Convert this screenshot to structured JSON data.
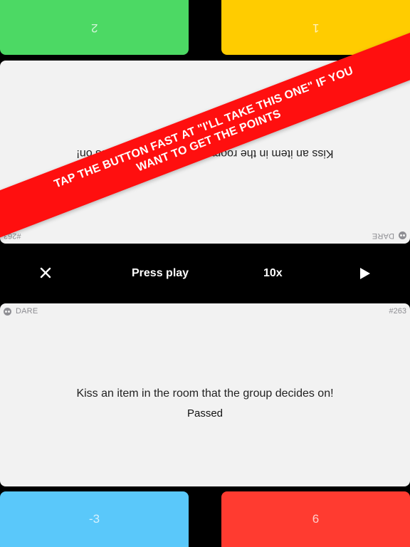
{
  "players": {
    "top_left": {
      "score": "2",
      "color": "#4cd964"
    },
    "top_right": {
      "score": "1",
      "color": "#ffcc00"
    },
    "bottom_left": {
      "score": "-3",
      "color": "#5ac8fa"
    },
    "bottom_right": {
      "score": "6",
      "color": "#ff3b30"
    }
  },
  "card": {
    "type": "DARE",
    "number": "#263",
    "text": "Kiss an item in the room that the group decides on!",
    "status": "Passed",
    "background": "#f2f2f2"
  },
  "controls": {
    "close_icon": "close-icon",
    "status_label": "Press play",
    "multiplier": "10x",
    "play_icon": "play-icon"
  },
  "banner": {
    "line1": "TAP THE BUTTON FAST AT \"I'LL TAKE THIS ONE\" IF YOU",
    "line2": "WANT TO GET THE POINTS",
    "color": "#ff0f0f"
  }
}
